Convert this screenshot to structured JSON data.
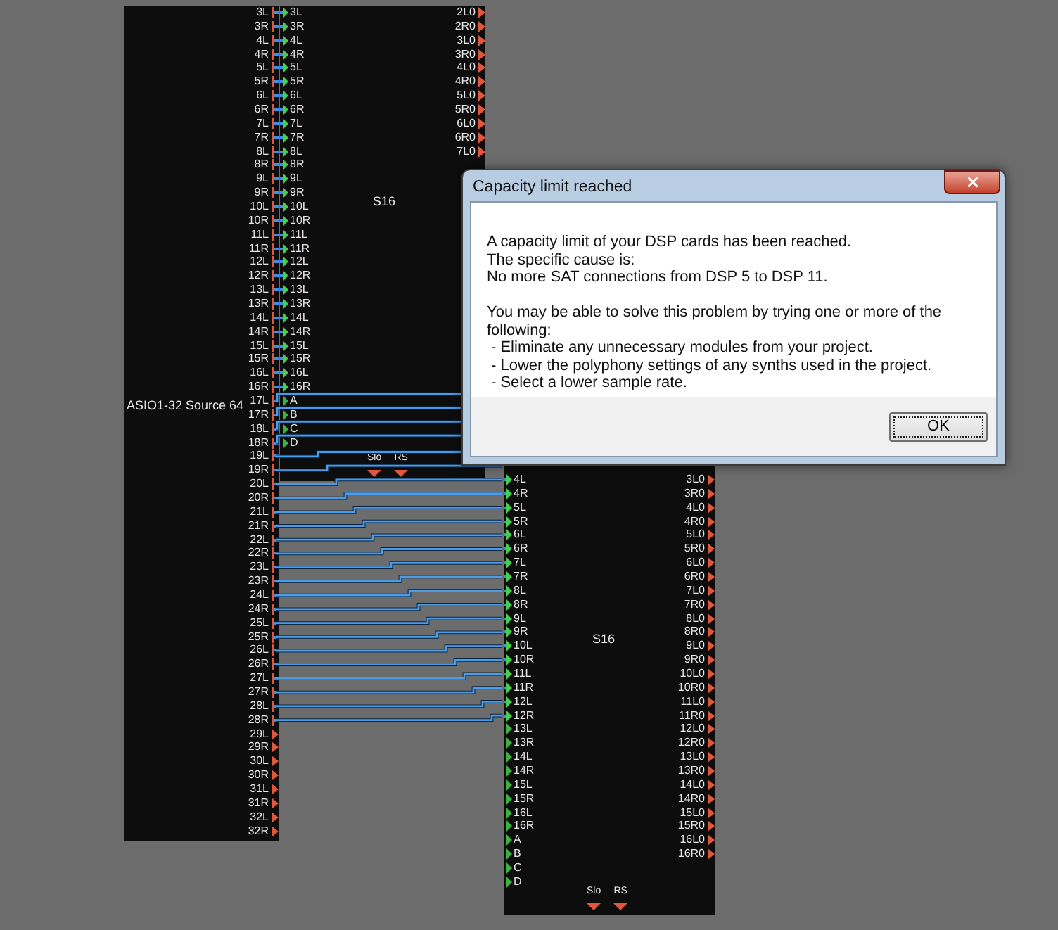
{
  "canvas": {
    "modules": [
      {
        "kind": "source",
        "name": "ASIO1-32 Source 64",
        "outputs": [
          {
            "label": "3L",
            "connected": true
          },
          {
            "label": "3R",
            "connected": true
          },
          {
            "label": "4L",
            "connected": true
          },
          {
            "label": "4R",
            "connected": true
          },
          {
            "label": "5L",
            "connected": true
          },
          {
            "label": "5R",
            "connected": true
          },
          {
            "label": "6L",
            "connected": true
          },
          {
            "label": "6R",
            "connected": true
          },
          {
            "label": "7L",
            "connected": true
          },
          {
            "label": "7R",
            "connected": true
          },
          {
            "label": "8L",
            "connected": true
          },
          {
            "label": "8R",
            "connected": true
          },
          {
            "label": "9L",
            "connected": true
          },
          {
            "label": "9R",
            "connected": true
          },
          {
            "label": "10L",
            "connected": true
          },
          {
            "label": "10R",
            "connected": true
          },
          {
            "label": "11L",
            "connected": true
          },
          {
            "label": "11R",
            "connected": true
          },
          {
            "label": "12L",
            "connected": true
          },
          {
            "label": "12R",
            "connected": true
          },
          {
            "label": "13L",
            "connected": true
          },
          {
            "label": "13R",
            "connected": true
          },
          {
            "label": "14L",
            "connected": true
          },
          {
            "label": "14R",
            "connected": true
          },
          {
            "label": "15L",
            "connected": true
          },
          {
            "label": "15R",
            "connected": true
          },
          {
            "label": "16L",
            "connected": true
          },
          {
            "label": "16R",
            "connected": true
          },
          {
            "label": "17L",
            "connected": true
          },
          {
            "label": "17R",
            "connected": true
          },
          {
            "label": "18L",
            "connected": true
          },
          {
            "label": "18R",
            "connected": true
          },
          {
            "label": "19L",
            "connected": true
          },
          {
            "label": "19R",
            "connected": true
          },
          {
            "label": "20L",
            "connected": true
          },
          {
            "label": "20R",
            "connected": true
          },
          {
            "label": "21L",
            "connected": true
          },
          {
            "label": "21R",
            "connected": true
          },
          {
            "label": "22L",
            "connected": true
          },
          {
            "label": "22R",
            "connected": true
          },
          {
            "label": "23L",
            "connected": true
          },
          {
            "label": "23R",
            "connected": true
          },
          {
            "label": "24L",
            "connected": true
          },
          {
            "label": "24R",
            "connected": true
          },
          {
            "label": "25L",
            "connected": true
          },
          {
            "label": "25R",
            "connected": true
          },
          {
            "label": "26L",
            "connected": true
          },
          {
            "label": "26R",
            "connected": true
          },
          {
            "label": "27L",
            "connected": true
          },
          {
            "label": "27R",
            "connected": true
          },
          {
            "label": "28L",
            "connected": true
          },
          {
            "label": "28R",
            "connected": true
          },
          {
            "label": "29L",
            "connected": false
          },
          {
            "label": "29R",
            "connected": false
          },
          {
            "label": "30L",
            "connected": false
          },
          {
            "label": "30R",
            "connected": false
          },
          {
            "label": "31L",
            "connected": false
          },
          {
            "label": "31R",
            "connected": false
          },
          {
            "label": "32L",
            "connected": false
          },
          {
            "label": "32R",
            "connected": false
          }
        ]
      },
      {
        "kind": "s16",
        "name": "S16",
        "inputs": [
          {
            "label": "3L",
            "connected": true
          },
          {
            "label": "3R",
            "connected": true
          },
          {
            "label": "4L",
            "connected": true
          },
          {
            "label": "4R",
            "connected": true
          },
          {
            "label": "5L",
            "connected": true
          },
          {
            "label": "5R",
            "connected": true
          },
          {
            "label": "6L",
            "connected": true
          },
          {
            "label": "6R",
            "connected": true
          },
          {
            "label": "7L",
            "connected": true
          },
          {
            "label": "7R",
            "connected": true
          },
          {
            "label": "8L",
            "connected": true
          },
          {
            "label": "8R",
            "connected": true
          },
          {
            "label": "9L",
            "connected": true
          },
          {
            "label": "9R",
            "connected": true
          },
          {
            "label": "10L",
            "connected": true
          },
          {
            "label": "10R",
            "connected": true
          },
          {
            "label": "11L",
            "connected": true
          },
          {
            "label": "11R",
            "connected": true
          },
          {
            "label": "12L",
            "connected": true
          },
          {
            "label": "12R",
            "connected": true
          },
          {
            "label": "13L",
            "connected": true
          },
          {
            "label": "13R",
            "connected": true
          },
          {
            "label": "14L",
            "connected": true
          },
          {
            "label": "14R",
            "connected": true
          },
          {
            "label": "15L",
            "connected": true
          },
          {
            "label": "15R",
            "connected": true
          },
          {
            "label": "16L",
            "connected": true
          },
          {
            "label": "16R",
            "connected": true
          },
          {
            "label": "A",
            "connected": false
          },
          {
            "label": "B",
            "connected": false
          },
          {
            "label": "C",
            "connected": false
          },
          {
            "label": "D",
            "connected": false
          }
        ],
        "outputs": [
          "2L0",
          "2R0",
          "3L0",
          "3R0",
          "4L0",
          "4R0",
          "5L0",
          "5R0",
          "6L0",
          "6R0",
          "7L0"
        ],
        "controls": [
          "Slo",
          "RS"
        ]
      },
      {
        "kind": "s16",
        "name": "S16",
        "inputs": [
          {
            "label": "4L",
            "connected": true
          },
          {
            "label": "4R",
            "connected": true
          },
          {
            "label": "5L",
            "connected": true
          },
          {
            "label": "5R",
            "connected": true
          },
          {
            "label": "6L",
            "connected": true
          },
          {
            "label": "6R",
            "connected": true
          },
          {
            "label": "7L",
            "connected": true
          },
          {
            "label": "7R",
            "connected": true
          },
          {
            "label": "8L",
            "connected": true
          },
          {
            "label": "8R",
            "connected": true
          },
          {
            "label": "9L",
            "connected": true
          },
          {
            "label": "9R",
            "connected": true
          },
          {
            "label": "10L",
            "connected": true
          },
          {
            "label": "10R",
            "connected": true
          },
          {
            "label": "11L",
            "connected": true
          },
          {
            "label": "11R",
            "connected": true
          },
          {
            "label": "12L",
            "connected": true
          },
          {
            "label": "12R",
            "connected": true
          },
          {
            "label": "13L",
            "connected": false
          },
          {
            "label": "13R",
            "connected": false
          },
          {
            "label": "14L",
            "connected": false
          },
          {
            "label": "14R",
            "connected": false
          },
          {
            "label": "15L",
            "connected": false
          },
          {
            "label": "15R",
            "connected": false
          },
          {
            "label": "16L",
            "connected": false
          },
          {
            "label": "16R",
            "connected": false
          },
          {
            "label": "A",
            "connected": false
          },
          {
            "label": "B",
            "connected": false
          },
          {
            "label": "C",
            "connected": false
          },
          {
            "label": "D",
            "connected": false
          }
        ],
        "outputs": [
          "3L0",
          "3R0",
          "4L0",
          "4R0",
          "5L0",
          "5R0",
          "6L0",
          "6R0",
          "7L0",
          "7R0",
          "8L0",
          "8R0",
          "9L0",
          "9R0",
          "10L0",
          "10R0",
          "11L0",
          "11R0",
          "12L0",
          "12R0",
          "13L0",
          "13R0",
          "14L0",
          "14R0",
          "15L0",
          "15R0",
          "16L0",
          "16R0"
        ],
        "controls": [
          "Slo",
          "RS"
        ]
      }
    ]
  },
  "dialog": {
    "title": "Capacity limit reached",
    "intro": [
      "A capacity limit of your DSP cards has been reached.",
      "The specific cause is:",
      "No more SAT connections from DSP 5 to DSP 11."
    ],
    "lead": "You may be able to solve this problem by trying one or more of the following:",
    "suggestions": [
      "- Eliminate any unnecessary modules from your project.",
      "- Lower the polyphony settings of any synths used in the project.",
      "- Select a lower sample rate."
    ],
    "buttons": [
      "OK"
    ]
  }
}
